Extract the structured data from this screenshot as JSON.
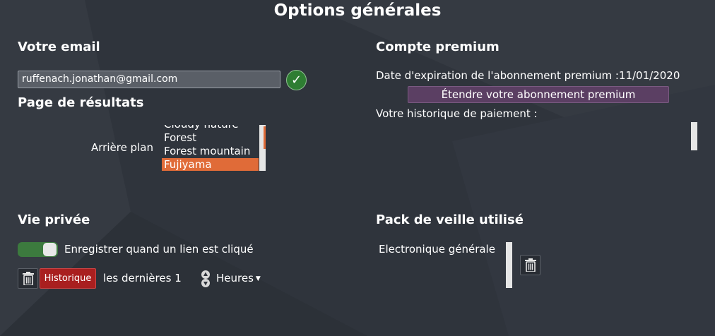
{
  "page": {
    "title": "Options générales"
  },
  "email_section": {
    "title": "Votre email",
    "email_value": "ruffenach.jonathan@gmail.com",
    "check_icon": "check-icon",
    "check_color": "#2e7d32"
  },
  "results_section": {
    "title": "Page de résultats",
    "background_label": "Arrière plan",
    "background_options": [
      "Cloudy nature",
      "Forest",
      "Forest mountain",
      "Fujiyama"
    ],
    "selected_option": "Fujiyama"
  },
  "premium_section": {
    "title": "Compte premium",
    "expiration_label": "Date d'expiration de l'abonnement premium :11/01/2020",
    "extend_button": "Étendre votre abonnement premium",
    "payment_history_label": "Votre historique de paiement :"
  },
  "privacy_section": {
    "title": "Vie privée",
    "toggle_label": "Enregistrer quand un lien est cliqué",
    "toggle_on": true,
    "history_button": "Historique",
    "last_label": "les dernières",
    "last_value": "1",
    "unit_selected": "Heures"
  },
  "pack_section": {
    "title": "Pack de veille utilisé",
    "pack_item": "Electronique générale"
  },
  "colors": {
    "background": "#2f343c",
    "accent_orange": "#e06b38",
    "premium_purple": "#5b3f63",
    "danger_red": "#a91f1f",
    "toggle_green": "#3c7a3e"
  }
}
